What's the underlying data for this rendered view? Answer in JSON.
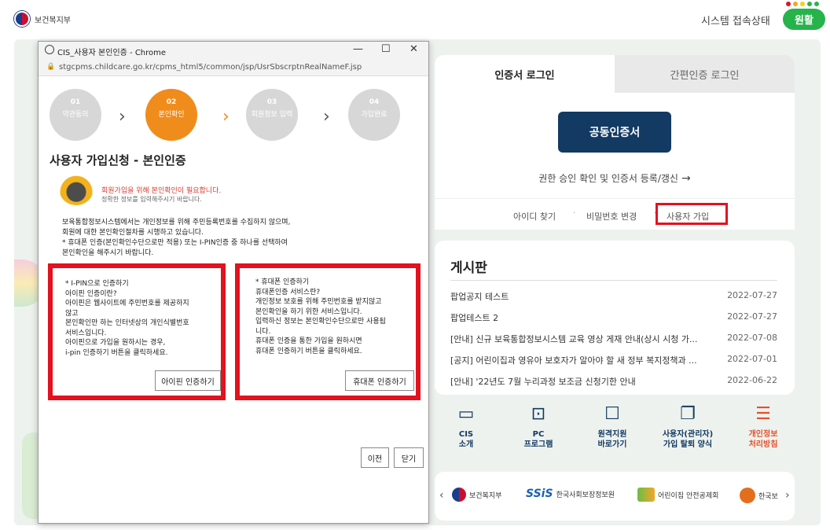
{
  "header": {
    "org_name": "보건복지부",
    "system_status_label": "시스템 접속상태",
    "status_value": "원활",
    "status_dot_colors": [
      "#e4111f",
      "#f3a72a",
      "#f3d21b",
      "#27b34b",
      "#27b34b"
    ]
  },
  "popup": {
    "window_title": "CIS_사용자 본인인증 - Chrome",
    "url": "stgcpms.childcare.go.kr/cpms_html5/common/jsp/UsrSbscrptnRealNameF.jsp",
    "steps": [
      {
        "num": "01",
        "label": "약관동의"
      },
      {
        "num": "02",
        "label": "본인확인"
      },
      {
        "num": "03",
        "label": "회원정보 입력"
      },
      {
        "num": "04",
        "label": "가입완료"
      }
    ],
    "heading": "사용자 가입신청 - 본인인증",
    "notice_red": "회원가입을 위해 본인확인이 필요합니다.",
    "notice_sub": "정확한 정보를 입력해주시기 바랍니다.",
    "intro_lines": [
      "보육통합정보시스템에서는 개인정보를 위해 주민등록번호를 수집하지 않으며,",
      "회원에 대한 본인확인절차를 시행하고 있습니다.",
      "* 휴대폰 인증(본인확인수단으로만 적용) 또는 I-PIN인증 중 하나를 선택하여",
      "  본인확인을 해주시기 바랍니다."
    ],
    "ipin_lines": [
      "* I-PIN으로 인증하기",
      "아이핀 인증이란?",
      "아이핀은 웹사이트에 주민번호를 제공하지",
      "않고",
      "본인확인만 하는 인터넷상의 개인식별번호",
      "서비스입니다.",
      "아이핀으로 가입을 원하시는 경우,",
      "i-pin 인증하기 버튼을 클릭하세요."
    ],
    "ipin_button": "아이핀 인증하기",
    "phone_lines": [
      "* 휴대폰 인증하기",
      "휴대폰인증 서비스란?",
      "개인정보 보호를 위해 주민번호를 받지않고",
      "본인확인을 하기 위한 서비스입니다.",
      "입력하신 정보는 본인확인수단으로만 사용됩",
      "니다.",
      "휴대폰 인증을 통한 가입을 원하시면",
      "휴대폰 인증하기 버튼을 클릭하세요."
    ],
    "phone_button": "휴대폰 인증하기",
    "prev_button": "이전",
    "close_button": "닫기"
  },
  "login": {
    "tab_cert": "인증서 로그인",
    "tab_simple": "간편인증 로그인",
    "cert_button": "공동인증서",
    "cert_renew": "권한 승인 확인 및 인증서 등록/갱신",
    "find_id": "아이디 찾기",
    "change_pw": "비밀번호 변경",
    "signup": "사용자 가입"
  },
  "board": {
    "title": "게시판",
    "rows": [
      {
        "title": "팝업공지 테스트",
        "date": "2022-07-27"
      },
      {
        "title": "팝업테스트 2",
        "date": "2022-07-27"
      },
      {
        "title": "[안내] 신규 보육통합정보시스템 교육 영상 게재 안내(상시 시청 가...",
        "date": "2022-07-08"
      },
      {
        "title": "[공지] 어린이집과 영유아 보호자가 알아야 할 새 정부 복지정책과 ...",
        "date": "2022-07-01"
      },
      {
        "title": "[안내] '22년도 7월 누리과정 보조금 신청기한 안내",
        "date": "2022-06-22"
      }
    ]
  },
  "quick": [
    {
      "icon": "monitor-icon",
      "label1": "CIS",
      "label2": "소개"
    },
    {
      "icon": "pc-icon",
      "label1": "PC",
      "label2": "프로그램"
    },
    {
      "icon": "remote-support-icon",
      "label1": "원격지원",
      "label2": "바로가기"
    },
    {
      "icon": "document-copy-icon",
      "label1": "사용자(관리자)",
      "label2": "가입 탈퇴 양식"
    },
    {
      "icon": "privacy-document-icon",
      "label1": "개인정보",
      "label2": "처리방침"
    }
  ],
  "partners": {
    "p1": "보건복지부",
    "p2_logo": "SSiS",
    "p2": "한국사회보장정보원",
    "p3": "어린이집 안전공제회",
    "p4": "한국보"
  }
}
